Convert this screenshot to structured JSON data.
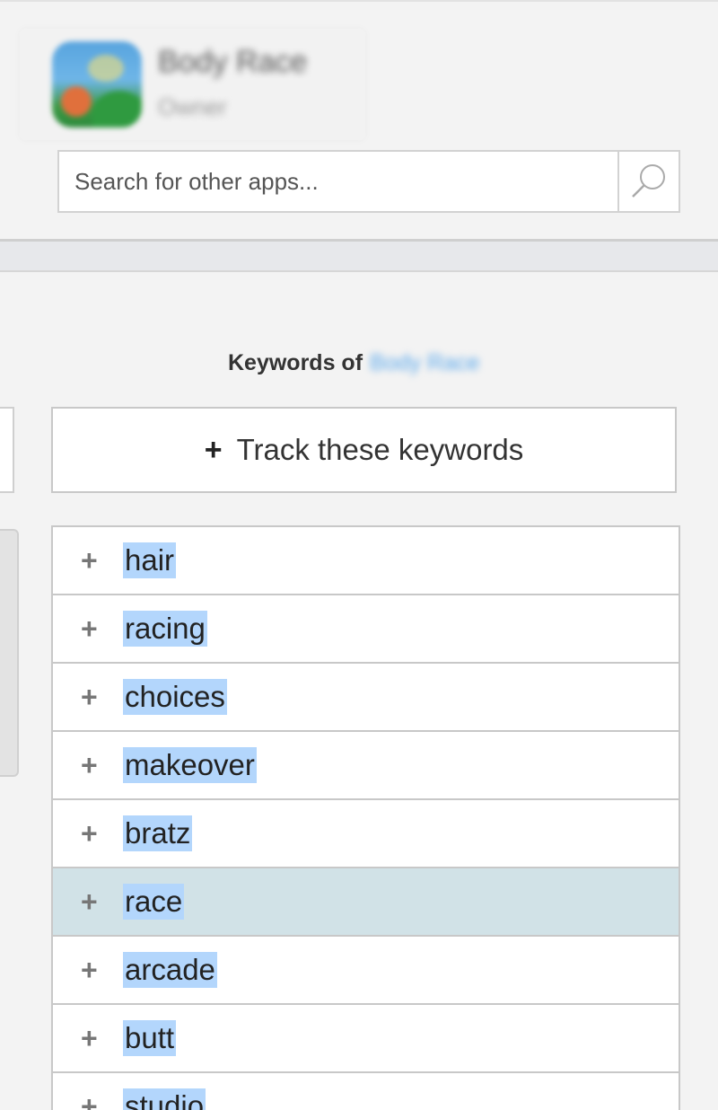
{
  "app": {
    "name": "Body Race",
    "subtitle": "Owner"
  },
  "search": {
    "placeholder": "Search for other apps...",
    "value": ""
  },
  "keywords_panel": {
    "heading_prefix": "Keywords of",
    "app_name": "Body Race",
    "track_plus": "+",
    "track_label": "Track these keywords",
    "row_plus": "+",
    "items": [
      "hair",
      "racing",
      "choices",
      "makeover",
      "bratz",
      "race",
      "arcade",
      "butt",
      "studio"
    ],
    "highlighted_item": "race"
  },
  "colors": {
    "selection": "#b3d6fc",
    "hover_row": "#d1e2e7",
    "link_blue": "#5aa8ec"
  }
}
